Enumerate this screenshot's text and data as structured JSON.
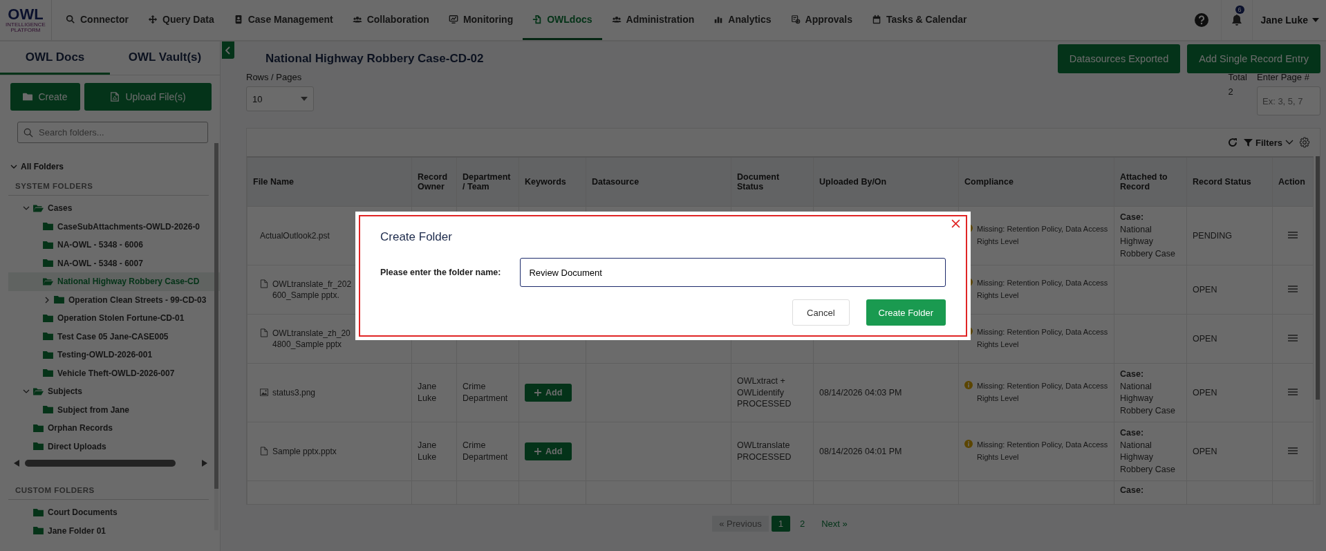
{
  "logo": {
    "title": "OWL",
    "subtitle": "INTELLIGENCE PLATFORM"
  },
  "nav": {
    "items": [
      {
        "label": "Connector",
        "selected": false
      },
      {
        "label": "Query Data",
        "selected": false
      },
      {
        "label": "Case Management",
        "selected": false
      },
      {
        "label": "Collaboration",
        "selected": false
      },
      {
        "label": "Monitoring",
        "selected": false
      },
      {
        "label": "OWLdocs",
        "selected": true
      },
      {
        "label": "Administration",
        "selected": false
      },
      {
        "label": "Analytics",
        "selected": false
      },
      {
        "label": "Approvals",
        "selected": false
      },
      {
        "label": "Tasks & Calendar",
        "selected": false
      }
    ],
    "notifications_badge": "6",
    "user": "Jane Luke"
  },
  "sidebar": {
    "tabs": [
      {
        "label": "OWL Docs",
        "selected": true
      },
      {
        "label": "OWL Vault(s)",
        "selected": false
      }
    ],
    "buttons": [
      "Create",
      "Upload File(s)"
    ],
    "search": {
      "placeholder": "Search folders..."
    },
    "root": {
      "label": "All Folders",
      "expanded": true
    },
    "sections": [
      {
        "title": "SYSTEM FOLDERS",
        "items": [
          {
            "label": "Cases",
            "expanded": true,
            "selected": false,
            "children": [
              {
                "label": "CaseSubAttachments-OWLD-2026-0",
                "selected": false
              },
              {
                "label": "NA-OWL - 5348 - 6006",
                "selected": false
              },
              {
                "label": "NA-OWL - 5348 - 6007",
                "selected": false
              },
              {
                "label": "National Highway Robbery Case-CD",
                "selected": true
              },
              {
                "label": "Operation Clean Streets - 99-CD-03",
                "selected": false,
                "expanded": false
              },
              {
                "label": "Operation Stolen Fortune-CD-01",
                "selected": false
              },
              {
                "label": "Test Case 05 Jane-CASE005",
                "selected": false
              },
              {
                "label": "Testing-OWLD-2026-001",
                "selected": false
              },
              {
                "label": "Vehicle Theft-OWLD-2026-007",
                "selected": false
              }
            ]
          },
          {
            "label": "Subjects",
            "expanded": true,
            "selected": false,
            "children": [
              {
                "label": "Subject from Jane",
                "selected": false
              }
            ]
          },
          {
            "label": "Orphan Records",
            "selected": false
          },
          {
            "label": "Direct Uploads",
            "selected": false
          }
        ]
      },
      {
        "title": "CUSTOM FOLDERS",
        "items": [
          {
            "label": "Court Documents",
            "selected": false
          },
          {
            "label": "Jane Folder 01",
            "selected": false
          }
        ]
      }
    ]
  },
  "main": {
    "title": "National Highway Robbery Case-CD-02",
    "buttons": [
      "Datasources Exported",
      "Add Single Record Entry"
    ],
    "rows_per_page": {
      "label": "Rows / Pages",
      "value": "10"
    },
    "total": {
      "label": "Total",
      "value": "2"
    },
    "page_input": {
      "label": "Enter Page #",
      "placeholder": "Ex: 3, 5, 7"
    },
    "toolbar": {
      "filters": "Filters"
    }
  },
  "table": {
    "columns": [
      "File Name",
      "Record Owner",
      "Department / Team",
      "Keywords",
      "Datasource",
      "Document Status",
      "Uploaded By/On",
      "Compliance",
      "Attached to Record",
      "Record Status",
      "Action"
    ],
    "rows": [
      {
        "file_name": "ActualOutlook2.pst",
        "compliance": "Missing: Retention Policy, Data Access Rights Level",
        "attached_label": "Case:",
        "attached_name": "National Highway Robbery Case",
        "record_status": "PENDING",
        "action_menu": true
      },
      {
        "kind": "document",
        "file_name": "OWLtranslate_fr_202\n600_Sample pptx.",
        "compliance": "Missing: Retention Policy, Data Access Rights Level",
        "record_status": "OPEN",
        "action_menu": true
      },
      {
        "kind": "document",
        "file_name": "OWLtranslate_zh_20\n4800_Sample pptx",
        "compliance": "Missing: Retention Policy, Data Access Rights Level",
        "record_status": "OPEN",
        "action_menu": true
      },
      {
        "kind": "image",
        "file_name": "status3.png",
        "owner": "Jane Luke",
        "department": "Crime Department",
        "keywords_button": "Add",
        "document_status": "OWLxtract + OWLidentify PROCESSED",
        "uploaded": "08/14/2026 04:03 PM",
        "compliance": "Missing: Retention Policy, Data Access Rights Level",
        "attached_label": "Case:",
        "attached_name": "National Highway Robbery Case",
        "record_status": "OPEN",
        "action_menu": true
      },
      {
        "kind": "document",
        "file_name": "Sample pptx.pptx",
        "owner": "Jane Luke",
        "department": "Crime Department",
        "keywords_button": "Add",
        "document_status": "OWLtranslate PROCESSED",
        "uploaded": "08/14/2026 04:01 PM",
        "compliance": "Missing: Retention Policy, Data Access Rights Level",
        "attached_label": "Case:",
        "attached_name": "National Highway Robbery Case",
        "record_status": "OPEN",
        "action_menu": true
      },
      {
        "attached_label": "Case:",
        "action_menu": false
      }
    ]
  },
  "pagination": {
    "previous": {
      "label": "« Previous",
      "disabled": true
    },
    "pages": [
      {
        "label": "1",
        "selected": true
      },
      {
        "label": "2",
        "selected": false
      }
    ],
    "next": {
      "label": "Next »",
      "disabled": false
    }
  },
  "modal": {
    "title": "Create Folder",
    "field_label": "Please enter the folder name:",
    "value": "Review Document",
    "buttons": [
      "Cancel",
      "Create Folder"
    ]
  }
}
